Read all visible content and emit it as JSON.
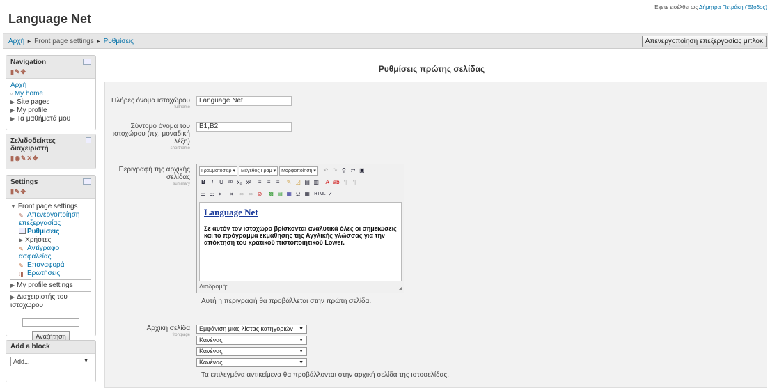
{
  "header": {
    "site_title": "Language Net",
    "login_prefix": "Έχετε εισέλθει ως",
    "login_user": "Δήμητρα Πετράκη",
    "logout": "(Έξοδος)"
  },
  "breadcrumb": {
    "items": [
      "Αρχή",
      "Front page settings",
      "Ρυθμίσεις"
    ],
    "separator": "►"
  },
  "edit_blocks_button": "Απενεργοποίηση επεξεργασίας μπλοκ",
  "navigation": {
    "title": "Navigation",
    "root": "Αρχή",
    "items": [
      {
        "label": "My home",
        "marker": "▫"
      },
      {
        "label": "Site pages",
        "marker": "▶"
      },
      {
        "label": "My profile",
        "marker": "▶"
      },
      {
        "label": "Τα μαθήματά μου",
        "marker": "▶"
      }
    ]
  },
  "bookmarks": {
    "title": "Σελιδοδείκτες διαχειριστή"
  },
  "settings": {
    "title": "Settings",
    "section": "Front page settings",
    "items": [
      {
        "label": "Απενεργοποίηση επεξεργασίας"
      },
      {
        "label": "Ρυθμίσεις"
      },
      {
        "label": "Χρήστες"
      },
      {
        "label": "Αντίγραφο ασφαλείας"
      },
      {
        "label": "Επαναφορά"
      },
      {
        "label": "Ερωτήσεις"
      }
    ],
    "profile_settings": "My profile settings",
    "site_admin": "Διαχειριστής του ιστοχώρου",
    "search_button": "Αναζήτηση"
  },
  "add_block": {
    "title": "Add a block",
    "select_value": "Add..."
  },
  "main": {
    "page_title": "Ρυθμίσεις πρώτης σελίδας",
    "fullname_label": "Πλήρες όνομα ιστοχώρου",
    "fullname_sub": "fullname",
    "fullname_value": "Language Net",
    "shortname_label": "Σύντομο όνομα του ιστοχώρου (πχ. μοναδική λέξη)",
    "shortname_sub": "shortname",
    "shortname_value": "B1,B2",
    "summary_label": "Περιγραφή της αρχικής σελίδας",
    "summary_sub": "summary",
    "editor": {
      "font_select": "Γραμματοσειρ",
      "size_select": "Μέγεθος Γραμ",
      "format_select": "Μορφοποίηση",
      "heading": "Language Net",
      "body": "Σε αυτόν τον ιστοχώρο βρίσκονται αναλυτικά όλες οι σημειώσεις και το πρόγραμμα εκμάθησης της Αγγλικής γλώσσας για την απόκτηση του κρατικού πιστοποιητικού Lower.",
      "path_label": "Διαδρομή:"
    },
    "summary_hint": "Αυτή η περιγραφή θα προβάλλεται στην πρώτη σελίδα.",
    "frontpage_label": "Αρχική σελίδα",
    "frontpage_sub": "frontpage",
    "frontpage_selects": [
      "Εμφάνιση μιας λίστας κατηγοριών",
      "Κανένας",
      "Κανένας",
      "Κανένας"
    ],
    "frontpage_hint": "Τα επιλεγμένα αντικείμενα θα προβάλλονται στην αρχική σελίδα της ιστοσελίδας."
  }
}
